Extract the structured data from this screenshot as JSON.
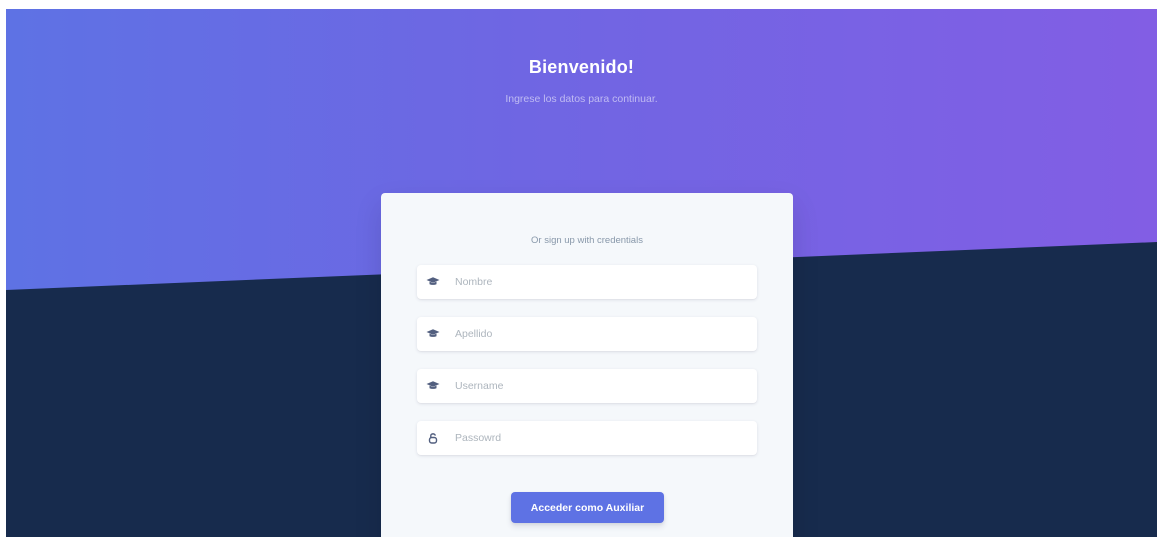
{
  "header": {
    "title": "Bienvenido!",
    "subtitle": "Ingrese los datos para continuar."
  },
  "form": {
    "caption": "Or sign up with credentials",
    "fields": [
      {
        "placeholder": "Nombre",
        "icon": "graduation-cap-icon"
      },
      {
        "placeholder": "Apellido",
        "icon": "graduation-cap-icon"
      },
      {
        "placeholder": "Username",
        "icon": "graduation-cap-icon"
      },
      {
        "placeholder": "Passowrd",
        "icon": "lock-icon"
      }
    ],
    "submit_label": "Acceder como Auxiliar"
  },
  "colors": {
    "gradient_start": "#5e72e4",
    "gradient_end": "#825ee4",
    "background_dark": "#172b4d",
    "card_background": "#f5f8fb",
    "button": "#5e72e4",
    "icon": "#525f7f"
  }
}
